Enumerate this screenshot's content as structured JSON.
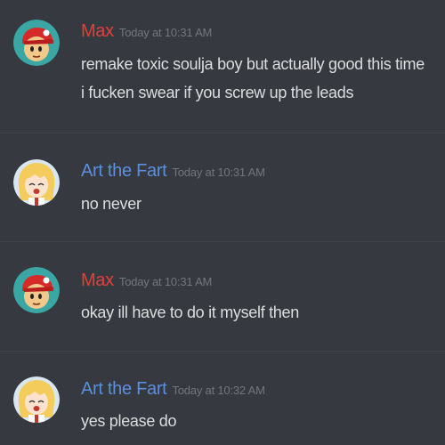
{
  "colors": {
    "background": "#36393f",
    "max_name": "#e0403f",
    "art_name": "#5a8fe0",
    "message_text": "#dcddde",
    "timestamp": "#72767d"
  },
  "messages": [
    {
      "author": "Max",
      "timestamp": "Today at 10:31 AM",
      "avatar": "max-avatar-icon",
      "lines": [
        "remake toxic soulja boy but actually good this time",
        "i fucken swear if you screw up the leads"
      ]
    },
    {
      "author": "Art the Fart",
      "timestamp": "Today at 10:31 AM",
      "avatar": "art-avatar-icon",
      "lines": [
        "no never"
      ]
    },
    {
      "author": "Max",
      "timestamp": "Today at 10:31 AM",
      "avatar": "max-avatar-icon",
      "lines": [
        "okay ill have to do it myself then"
      ]
    },
    {
      "author": "Art the Fart",
      "timestamp": "Today at 10:32 AM",
      "avatar": "art-avatar-icon",
      "lines": [
        "yes please do"
      ]
    }
  ]
}
